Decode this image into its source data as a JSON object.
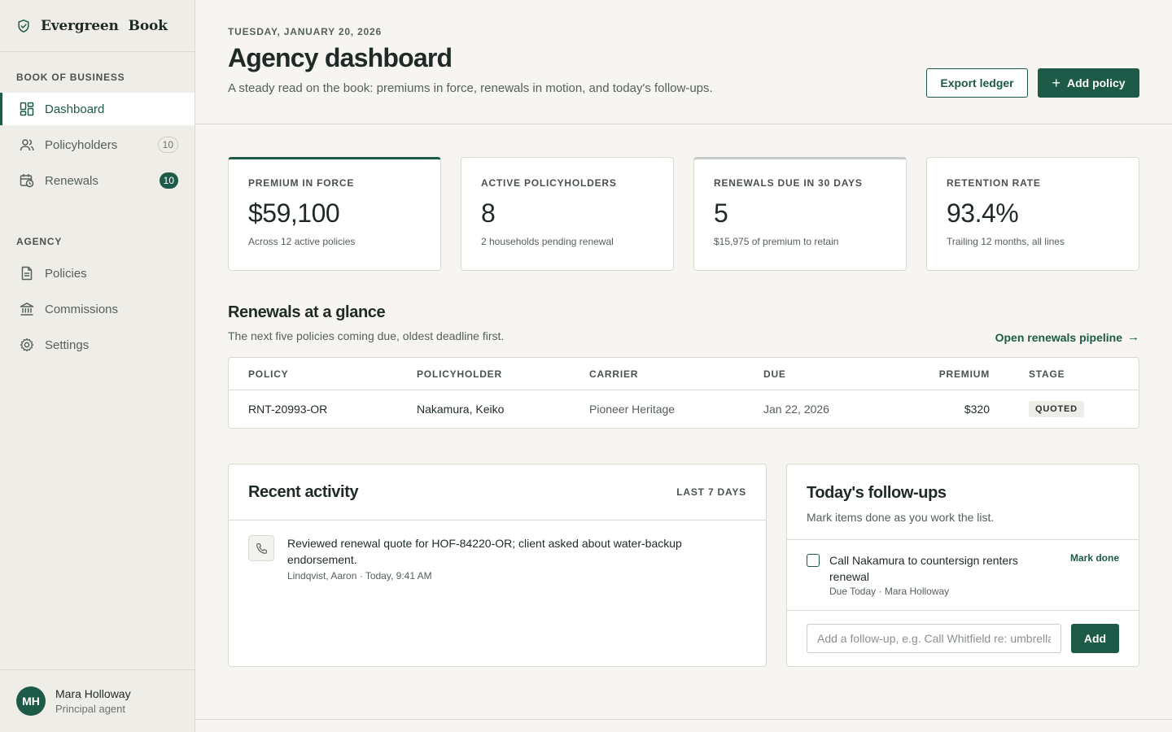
{
  "brand": {
    "name_first": "Evergreen",
    "name_second": "Book"
  },
  "sidebar": {
    "sections": [
      {
        "heading": "BOOK OF BUSINESS",
        "items": [
          {
            "label": "Dashboard",
            "icon": "dashboard-icon",
            "active": true
          },
          {
            "label": "Policyholders",
            "icon": "users-icon",
            "badge": "10"
          },
          {
            "label": "Renewals",
            "icon": "calendar-clock-icon",
            "badge": "10"
          }
        ]
      },
      {
        "heading": "AGENCY",
        "items": [
          {
            "label": "Policies",
            "icon": "document-icon"
          },
          {
            "label": "Commissions",
            "icon": "bank-icon"
          },
          {
            "label": "Settings",
            "icon": "gear-icon"
          }
        ]
      }
    ],
    "user": {
      "initials": "MH",
      "name": "Mara Holloway",
      "role": "Principal agent"
    }
  },
  "header": {
    "date": "TUESDAY, JANUARY 20, 2026",
    "title": "Agency dashboard",
    "subtitle": "A steady read on the book: premiums in force, renewals in motion, and today's follow-ups.",
    "export_label": "Export ledger",
    "add_label": "Add policy"
  },
  "kpis": [
    {
      "label": "PREMIUM IN FORCE",
      "value": "$59,100",
      "note": "Across 12 active policies"
    },
    {
      "label": "ACTIVE POLICYHOLDERS",
      "value": "8",
      "note": "2 households pending renewal"
    },
    {
      "label": "RENEWALS DUE IN 30 DAYS",
      "value": "5",
      "note": "$15,975 of premium to retain"
    },
    {
      "label": "RETENTION RATE",
      "value": "93.4%",
      "note": "Trailing 12 months, all lines"
    }
  ],
  "renewals": {
    "title": "Renewals at a glance",
    "subtitle": "The next five policies coming due, oldest deadline first.",
    "link_label": "Open renewals pipeline",
    "columns": [
      "POLICY",
      "POLICYHOLDER",
      "CARRIER",
      "DUE",
      "PREMIUM",
      "STAGE"
    ],
    "rows": [
      {
        "policy": "RNT-20993-OR",
        "holder": "Nakamura, Keiko",
        "carrier": "Pioneer Heritage",
        "due": "Jan 22, 2026",
        "premium": "$320",
        "stage": "QUOTED"
      }
    ]
  },
  "activity": {
    "title": "Recent activity",
    "range": "LAST 7 DAYS",
    "items": [
      {
        "icon": "phone-icon",
        "text": "Reviewed renewal quote for HOF-84220-OR; client asked about water-backup endorsement.",
        "meta": "Lindqvist, Aaron · Today, 9:41 AM"
      }
    ]
  },
  "followups": {
    "title": "Today's follow-ups",
    "subtitle": "Mark items done as you work the list.",
    "items": [
      {
        "text": "Call Nakamura to countersign renters renewal",
        "meta": "Due Today · Mara Holloway",
        "action": "Mark done"
      }
    ],
    "input_placeholder": "Add a follow-up, e.g. Call Whitfield re: umbrella",
    "add_label": "Add"
  },
  "colors": {
    "accent": "#1d5a48",
    "background": "#f6f5f1",
    "sidebar": "#efede7"
  }
}
